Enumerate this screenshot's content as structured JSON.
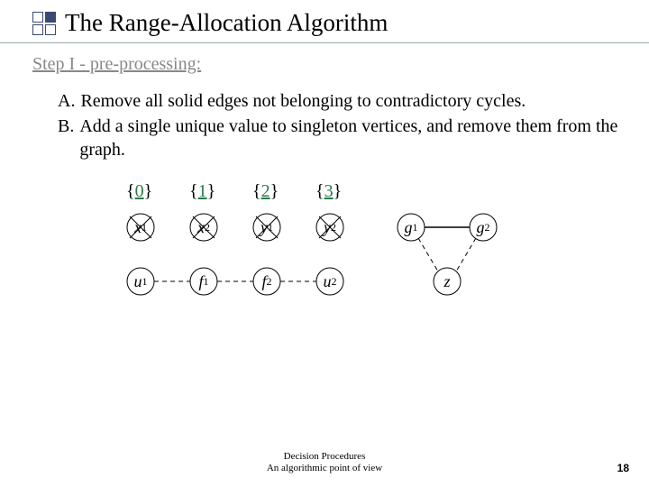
{
  "title": "The Range-Allocation Algorithm",
  "subhead": "Step I - pre-processing:",
  "items": [
    {
      "marker": "A.",
      "text": "Remove all solid edges not belonging to contradictory cycles."
    },
    {
      "marker": "B.",
      "text": "Add a single unique value to singleton vertices, and remove them from the graph."
    }
  ],
  "values": [
    "0",
    "1",
    "2",
    "3"
  ],
  "nodes": {
    "x1": {
      "base": "x",
      "sub": "1"
    },
    "x2": {
      "base": "x",
      "sub": "2"
    },
    "y1": {
      "base": "y",
      "sub": "1"
    },
    "y2": {
      "base": "y",
      "sub": "2"
    },
    "u1": {
      "base": "u",
      "sub": "1"
    },
    "f1": {
      "base": "f",
      "sub": "1"
    },
    "f2": {
      "base": "f",
      "sub": "2"
    },
    "u2": {
      "base": "u",
      "sub": "2"
    },
    "g1": {
      "base": "g",
      "sub": "1"
    },
    "g2": {
      "base": "g",
      "sub": "2"
    },
    "z": {
      "base": "z",
      "sub": ""
    }
  },
  "footer": {
    "line1": "Decision Procedures",
    "line2": "An algorithmic point of view"
  },
  "page": "18"
}
